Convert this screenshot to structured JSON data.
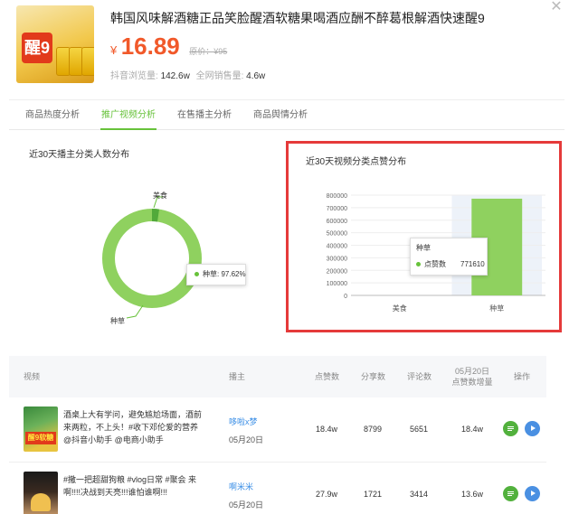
{
  "product": {
    "title": "韩国风味解酒糖正品笑脸醒酒软糖果喝酒应酬不醉葛根解酒快速醒9",
    "currency_symbol": "¥",
    "price": "16.89",
    "original_price": "原价：¥95",
    "stats": [
      {
        "label": "抖音浏览量:",
        "value": "142.6w"
      },
      {
        "label": "全网销售量:",
        "value": "4.6w"
      }
    ],
    "thumb_text": "醒9"
  },
  "tabs": [
    {
      "label": "商品热度分析",
      "active": false
    },
    {
      "label": "推广视频分析",
      "active": true
    },
    {
      "label": "在售播主分析",
      "active": false
    },
    {
      "label": "商品舆情分析",
      "active": false
    }
  ],
  "donut": {
    "title": "近30天播主分类人数分布",
    "label_top": "美食",
    "label_bottom": "种草",
    "tooltip": "种草: 97.62%"
  },
  "chart_data": {
    "type": "bar",
    "title": "近30天视频分类点赞分布",
    "categories": [
      "美食",
      "种草"
    ],
    "values": [
      0,
      771610
    ],
    "ylim": [
      0,
      800000
    ],
    "yticks": [
      "800000",
      "700000",
      "600000",
      "500000",
      "400000",
      "300000",
      "200000",
      "100000",
      "0"
    ],
    "grid": true,
    "bar_color": "#8fd15f",
    "tooltip": {
      "category": "种草",
      "series": "点赞数",
      "value": "771610"
    }
  },
  "table": {
    "headers": {
      "video": "视频",
      "author": "播主",
      "likes": "点赞数",
      "shares": "分享数",
      "comments": "评论数",
      "inc_line1": "05月20日",
      "inc_line2": "点赞数增量",
      "ops": "操作"
    },
    "rows": [
      {
        "text": "酒桌上大有学问，避免尴尬场面，酒前来两粒，不上头！#收下邓伦爱的营养 @抖音小助手 @电商小助手",
        "author": "哆啦x梦",
        "date": "05月20日",
        "likes": "18.4w",
        "shares": "8799",
        "comments": "5651",
        "increment": "18.4w",
        "thumb_caption": "醒9软糖"
      },
      {
        "text": "#撒一把超甜狗粮 #vlog日常 #聚会 来啊!!!!决战到天亮!!!谁怕谁啊!!!",
        "author": "啊米米",
        "date": "05月20日",
        "likes": "27.9w",
        "shares": "1721",
        "comments": "3414",
        "increment": "13.6w",
        "thumb_caption": ""
      }
    ]
  }
}
